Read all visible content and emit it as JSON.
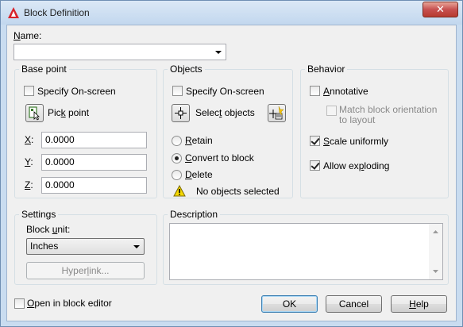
{
  "window": {
    "title": "Block Definition",
    "close_glyph": "✕"
  },
  "name": {
    "label_prefix": "",
    "label_accel": "N",
    "label_rest": "ame:",
    "value": ""
  },
  "base_point": {
    "title": "Base point",
    "specify_onscreen": "Specify On-screen",
    "specify_onscreen_checked": false,
    "pick_point_pre": "Pic",
    "pick_point_accel": "k",
    "pick_point_post": " point",
    "x_label": "X",
    "x_sep": ":",
    "x_value": "0.0000",
    "y_label": "Y",
    "y_sep": ":",
    "y_value": "0.0000",
    "z_label": "Z",
    "z_sep": ":",
    "z_value": "0.0000"
  },
  "objects": {
    "title": "Objects",
    "specify_onscreen": "Specify On-screen",
    "specify_onscreen_checked": false,
    "select_objects_pre": "Selec",
    "select_objects_accel": "t",
    "select_objects_post": " objects",
    "retain_accel": "R",
    "retain_rest": "etain",
    "convert_accel": "C",
    "convert_rest": "onvert to block",
    "delete_accel": "D",
    "delete_rest": "elete",
    "selected_option": "convert",
    "warning_text": "No objects selected"
  },
  "behavior": {
    "title": "Behavior",
    "annotative_accel": "A",
    "annotative_rest": "nnotative",
    "annotative_checked": false,
    "match_orientation_line1": "Match block orientation",
    "match_orientation_line2": "to layout",
    "match_orientation_checked": false,
    "scale_uniformly_pre": "",
    "scale_uniformly_accel": "S",
    "scale_uniformly_rest": "cale uniformly",
    "scale_uniformly_checked": true,
    "allow_exploding_pre": "Allow ex",
    "allow_exploding_accel": "p",
    "allow_exploding_post": "loding",
    "allow_exploding_checked": true
  },
  "settings": {
    "title": "Settings",
    "block_unit_pre": "Block ",
    "block_unit_accel": "u",
    "block_unit_post": "nit:",
    "block_unit_value": "Inches",
    "hyperlink_pre": "Hyper",
    "hyperlink_accel": "l",
    "hyperlink_post": "ink..."
  },
  "description": {
    "title": "Description",
    "value": ""
  },
  "footer": {
    "open_editor_pre": "",
    "open_editor_accel": "O",
    "open_editor_rest": "pen in block editor",
    "open_editor_checked": false,
    "ok": "OK",
    "cancel": "Cancel",
    "help_accel": "H",
    "help_rest": "elp"
  },
  "colors": {
    "accent": "#3c7fb1",
    "warning": "#f5d800",
    "logo": "#d8232a"
  }
}
